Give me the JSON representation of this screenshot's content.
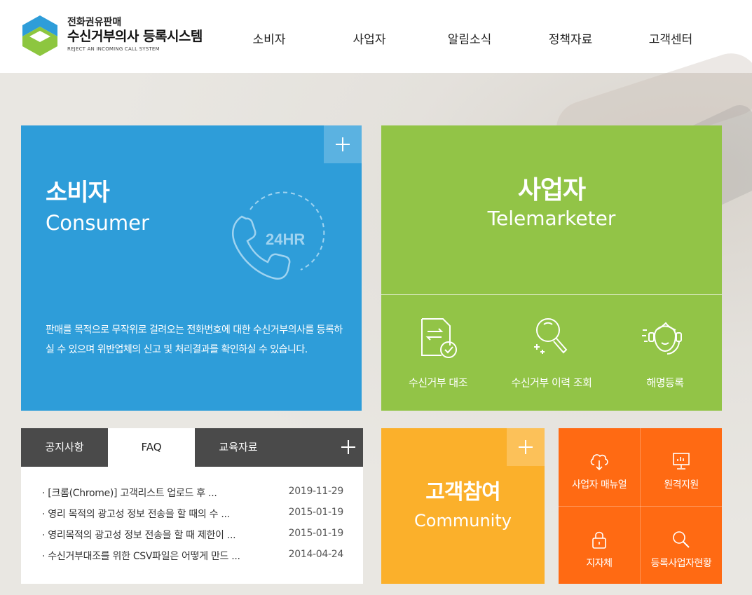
{
  "header": {
    "logo_sub": "전화권유판매",
    "logo_main": "수신거부의사 등록시스템",
    "logo_en": "REJECT AN INCOMING CALL SYSTEM"
  },
  "nav": [
    "소비자",
    "사업자",
    "알림소식",
    "정책자료",
    "고객센터"
  ],
  "consumer": {
    "title": "소비자",
    "subtitle": "Consumer",
    "badge": "24HR",
    "description": "판매를 목적으로 무작위로 걸려오는 전화번호에 대한 수신거부의사를 등록하실 수 있으며 위반업체의 신고 및 처리결과를 확인하실 수 있습니다."
  },
  "business": {
    "title": "사업자",
    "subtitle": "Telemarketer",
    "items": [
      {
        "label": "수신거부 대조",
        "icon": "document-compare-icon"
      },
      {
        "label": "수신거부 이력 조회",
        "icon": "magnifier-icon"
      },
      {
        "label": "해명등록",
        "icon": "headset-agent-icon"
      }
    ]
  },
  "tabs": {
    "items": [
      "공지사항",
      "FAQ",
      "교육자료"
    ],
    "active": "FAQ",
    "faq": [
      {
        "q": "· [크롬(Chrome)] 고객리스트 업로드 후 ...",
        "date": "2019-11-29"
      },
      {
        "q": "· 영리 목적의 광고성 정보 전송을 할 때의 수 ...",
        "date": "2015-01-19"
      },
      {
        "q": "· 영리목적의 광고성 정보 전송을 할 때 제한이 ...",
        "date": "2015-01-19"
      },
      {
        "q": "· 수신거부대조를 위한 CSV파일은 어떻게 만드 ...",
        "date": "2014-04-24"
      }
    ]
  },
  "community": {
    "title": "고객참여",
    "subtitle": "Community"
  },
  "quick": [
    {
      "label": "사업자 매뉴얼",
      "icon": "cloud-download-icon"
    },
    {
      "label": "원격지원",
      "icon": "monitor-icon"
    },
    {
      "label": "지자체",
      "icon": "lock-icon"
    },
    {
      "label": "등록사업자현황",
      "icon": "search-icon"
    }
  ],
  "colors": {
    "consumer": "#2e9dd9",
    "business": "#92c447",
    "community": "#fbb02b",
    "quick": "#ff6a13",
    "tabbar": "#4a4a4a"
  }
}
